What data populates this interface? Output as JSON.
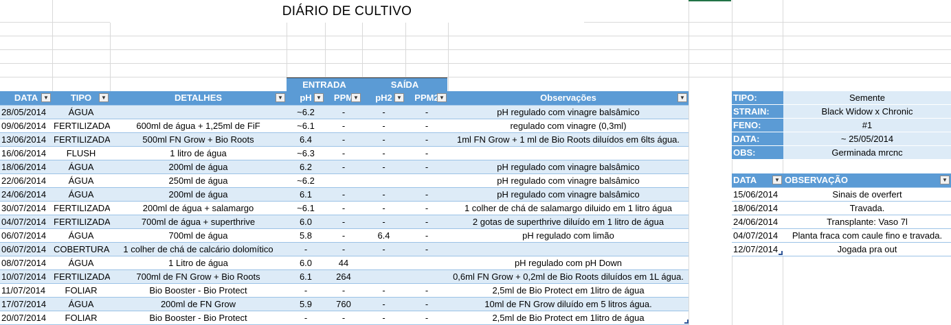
{
  "title": "DIÁRIO DE CULTIVO",
  "groups": {
    "entrada": "ENTRADA",
    "saida": "SAÍDA"
  },
  "main": {
    "headers": [
      "DATA",
      "TIPO",
      "DETALHES",
      "pH",
      "PPM",
      "pH2",
      "PPM2",
      "Observações"
    ],
    "rows": [
      [
        "28/05/2014",
        "ÁGUA",
        "",
        "~6.2",
        "-",
        "-",
        "-",
        "pH regulado com vinagre balsâmico"
      ],
      [
        "09/06/2014",
        "FERTILIZADA",
        "600ml de água + 1,25ml de FiF",
        "~6.1",
        "-",
        "-",
        "-",
        "regulado com vinagre (0,3ml)"
      ],
      [
        "13/06/2014",
        "FERTILIZADA",
        "500ml FN Grow + Bio Roots",
        "6.4",
        "-",
        "-",
        "-",
        "1ml FN Grow + 1 ml de Bio Roots diluídos em 6lts água."
      ],
      [
        "16/06/2014",
        "FLUSH",
        "1 litro de água",
        "~6.3",
        "-",
        "-",
        "-",
        ""
      ],
      [
        "18/06/2014",
        "ÁGUA",
        "200ml de água",
        "6.2",
        "-",
        "-",
        "-",
        "pH regulado com vinagre balsâmico"
      ],
      [
        "22/06/2014",
        "ÁGUA",
        "250ml de água",
        "~6.2",
        "",
        "",
        "",
        "pH regulado com vinagre balsâmico"
      ],
      [
        "24/06/2014",
        "ÁGUA",
        "200ml de água",
        "6.1",
        "-",
        "-",
        "-",
        "pH regulado com vinagre balsâmico"
      ],
      [
        "30/07/2014",
        "FERTILIZADA",
        "200ml de água + salamargo",
        "~6.1",
        "-",
        "-",
        "-",
        "1 colher de chá de salamargo diluido em 1 litro água"
      ],
      [
        "04/07/2014",
        "FERTILIZADA",
        "700ml de água + superthrive",
        "6.0",
        "-",
        "-",
        "-",
        "2 gotas de superthrive diluído em 1 litro de água"
      ],
      [
        "06/07/2014",
        "ÁGUA",
        "700ml de água",
        "5.8",
        "-",
        "6.4",
        "-",
        "pH regulado com limão"
      ],
      [
        "06/07/2014",
        "COBERTURA",
        "1 colher de chá de calcário dolomítico",
        "-",
        "-",
        "-",
        "-",
        ""
      ],
      [
        "08/07/2014",
        "ÁGUA",
        "1 Litro de água",
        "6.0",
        "44",
        "",
        "",
        "pH regulado com pH Down"
      ],
      [
        "10/07/2014",
        "FERTILIZADA",
        "700ml de FN Grow + Bio Roots",
        "6.1",
        "264",
        "",
        "",
        "0,6ml FN Grow + 0,2ml de Bio Roots diluídos em 1L água."
      ],
      [
        "11/07/2014",
        "FOLIAR",
        "Bio Booster - Bio Protect",
        "-",
        "-",
        "-",
        "-",
        "2,5ml de Bio Protect em 1litro de água"
      ],
      [
        "17/07/2014",
        "ÁGUA",
        "200ml de FN Grow",
        "5.9",
        "760",
        "-",
        "-",
        "10ml de FN Grow diluído em 5 litros água."
      ],
      [
        "20/07/2014",
        "FOLIAR",
        "Bio Booster - Bio Protect",
        "-",
        "-",
        "-",
        "-",
        "2,5ml de Bio Protect em 1litro de água"
      ]
    ]
  },
  "info": {
    "rows": [
      [
        "TIPO:",
        "Semente"
      ],
      [
        "STRAIN:",
        "Black Widow x Chronic"
      ],
      [
        "FENO:",
        "#1"
      ],
      [
        "DATA:",
        "~ 25/05/2014"
      ],
      [
        "OBS:",
        "Germinada mrcnc"
      ]
    ]
  },
  "obs": {
    "headers": [
      "DATA",
      "OBSERVAÇÃO"
    ],
    "rows": [
      [
        "15/06/2014",
        "Sinais de overfert"
      ],
      [
        "18/06/2014",
        "Travada."
      ],
      [
        "24/06/2014",
        "Transplante: Vaso 7l"
      ],
      [
        "04/07/2014",
        "Planta fraca com caule fino e travada."
      ],
      [
        "12/07/2014",
        "Jogada pra out"
      ]
    ]
  },
  "icons": {
    "filter": "dropdown-arrow-icon"
  },
  "colors": {
    "header": "#5b9bd5",
    "band": "#ddebf7",
    "grid": "#d9d9d9",
    "selection": "#217346"
  }
}
